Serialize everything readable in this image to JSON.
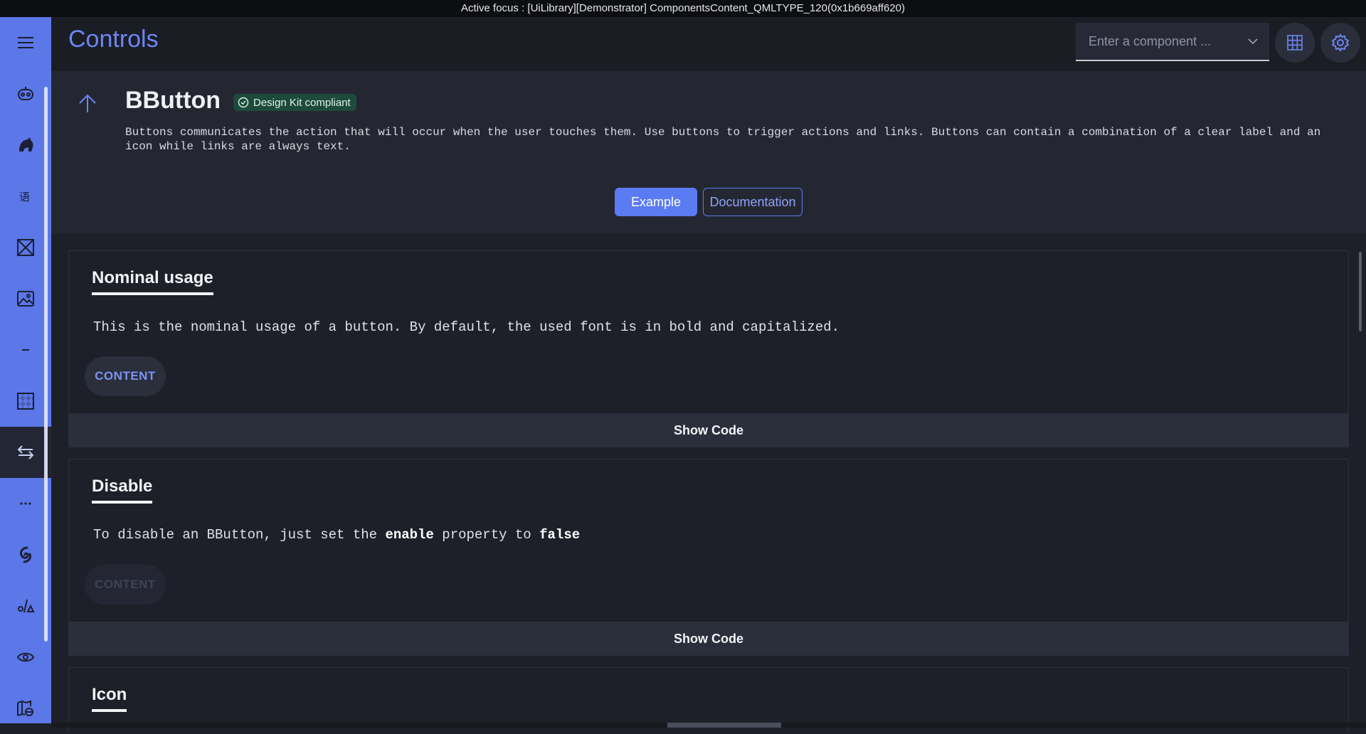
{
  "titlebar": "Active focus : [UiLibrary][Demonstrator] ComponentsContent_QMLTYPE_120(0x1b669aff620)",
  "header": {
    "title": "Controls",
    "search_placeholder": "Enter a component ..."
  },
  "sidebar": {
    "items": [
      {
        "icon": "menu-icon"
      },
      {
        "icon": "robot-icon"
      },
      {
        "icon": "horse-icon"
      },
      {
        "icon": "translate-icon"
      },
      {
        "icon": "placeholder-box-icon"
      },
      {
        "icon": "image-icon"
      },
      {
        "icon": "divider-icon"
      },
      {
        "icon": "grid-icon"
      },
      {
        "icon": "swap-arrows-icon",
        "active": true
      },
      {
        "icon": "more-icon"
      },
      {
        "icon": "spiral-icon"
      },
      {
        "icon": "shapes-icon"
      },
      {
        "icon": "eye-icon"
      },
      {
        "icon": "map-globe-icon"
      }
    ]
  },
  "component": {
    "name": "BButton",
    "badge": "Design Kit compliant",
    "description": "Buttons communicates the action that will occur when the user touches them. Use buttons to trigger actions and links. Buttons can contain a combination of a clear label and an icon while links are always text.",
    "tabs": {
      "example": "Example",
      "documentation": "Documentation"
    }
  },
  "sections": {
    "nominal": {
      "title": "Nominal usage",
      "text": "This is the nominal usage of a button. By default, the used font is in bold and capitalized.",
      "button": "CONTENT",
      "show_code": "Show Code"
    },
    "disable": {
      "title": "Disable",
      "text_pre": "To disable an BButton, just set the ",
      "text_bold1": "enable",
      "text_mid": " property to ",
      "text_bold2": "false",
      "button": "CONTENT",
      "show_code": "Show Code"
    },
    "icon": {
      "title": "Icon"
    }
  },
  "colors": {
    "accent": "#5b7bf3",
    "sidebar": "#5b77e8",
    "badge_bg": "#1e4a3c"
  }
}
